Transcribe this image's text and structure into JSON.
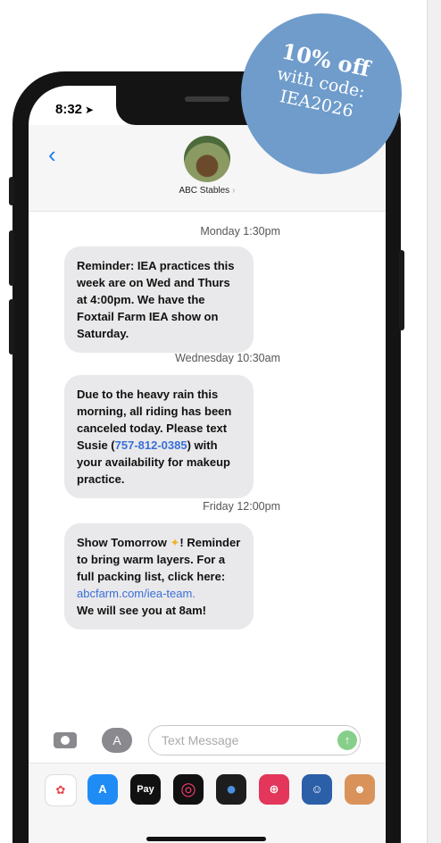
{
  "status_bar": {
    "time": "8:32"
  },
  "header": {
    "contact_name": "ABC Stables"
  },
  "messages": [
    {
      "timestamp": "Monday 1:30pm",
      "text": "Reminder: IEA practices this week are on Wed and Thurs at 4:00pm. We have the Foxtail Farm IEA show on Saturday."
    },
    {
      "timestamp": "Wednesday 10:30am",
      "text_before": "Due to the heavy rain this morning, all riding has been canceled today. Please text Susie (",
      "phone": "757-812-0385",
      "text_after": ") with your availability for makeup practice."
    },
    {
      "timestamp": "Friday 12:00pm",
      "text_before": "Show Tomorrow ",
      "text_mid": "! Reminder to bring warm layers. For a full packing list, click here:",
      "link": "abcfarm.com/iea-team.",
      "text_after": "We will see you at 8am!"
    }
  ],
  "input": {
    "placeholder": "Text Message"
  },
  "dock": {
    "pay_label": "Pay"
  },
  "promo": {
    "title": "10% off",
    "line1": "with code:",
    "line2": "IEA2026"
  },
  "colors": {
    "promo_bg": "#6f9ccb",
    "link": "#3a6fd8",
    "ios_blue": "#1d7cf2",
    "bubble": "#e9e9eb"
  }
}
